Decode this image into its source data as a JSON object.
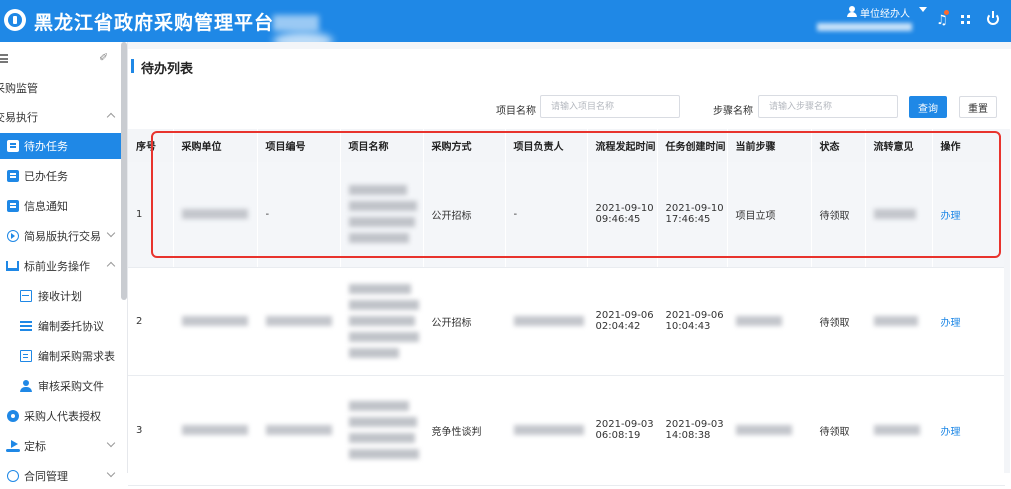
{
  "header": {
    "app_title": "黑龙江省政府采购管理平台",
    "user_name": "单位经办人",
    "brand_color": "#1f88e6"
  },
  "icons": {
    "logo": "logo-badge-icon",
    "user": "user-icon",
    "dropdown": "caret-down-icon",
    "notifications": "bell-icon",
    "apps": "grid-icon",
    "logout": "power-icon",
    "menu": "menu-toggle-icon",
    "pin": "pin-icon"
  },
  "sidebar": {
    "items": [
      {
        "label": "采购监管",
        "indent": false,
        "expanded": null
      },
      {
        "label": "交易执行",
        "indent": false,
        "expanded": true
      },
      {
        "label": "待办任务",
        "indent": true,
        "active": true
      },
      {
        "label": "已办任务",
        "indent": true
      },
      {
        "label": "信息通知",
        "indent": true
      },
      {
        "label": "简易版执行交易",
        "indent": true,
        "expanded": false
      },
      {
        "label": "标前业务操作",
        "indent": true,
        "expanded": true
      },
      {
        "label": "接收计划",
        "indent": true
      },
      {
        "label": "编制委托协议",
        "indent": true
      },
      {
        "label": "编制采购需求表",
        "indent": true
      },
      {
        "label": "审核采购文件",
        "indent": true
      },
      {
        "label": "采购人代表授权",
        "indent": false
      },
      {
        "label": "定标",
        "indent": false,
        "expanded": false
      },
      {
        "label": "合同管理",
        "indent": false,
        "expanded": false
      }
    ]
  },
  "main": {
    "page_title": "待办列表",
    "filters": {
      "project_name_label": "项目名称",
      "project_name_placeholder": "请输入项目名称",
      "step_name_label": "步骤名称",
      "step_name_placeholder": "请输入步骤名称",
      "query_label": "查询",
      "reset_label": "重置"
    },
    "table": {
      "columns": [
        "序号",
        "采购单位",
        "项目编号",
        "项目名称",
        "采购方式",
        "项目负责人",
        "流程发起时间",
        "任务创建时间",
        "当前步骤",
        "状态",
        "流转意见",
        "操作"
      ],
      "rows": [
        {
          "no": "1",
          "project_code": "-",
          "method": "公开招标",
          "manager": "-",
          "start_date": "2021-09-10",
          "start_time": "09:46:45",
          "create_date": "2021-09-10",
          "create_time": "17:46:45",
          "step": "项目立项",
          "status": "待领取",
          "action": "办理"
        },
        {
          "no": "2",
          "project_code": "",
          "method": "公开招标",
          "manager": "",
          "start_date": "2021-09-06",
          "start_time": "02:04:42",
          "create_date": "2021-09-06",
          "create_time": "10:04:43",
          "step": "",
          "status": "待领取",
          "action": "办理"
        },
        {
          "no": "3",
          "project_code": "",
          "method": "竞争性谈判",
          "manager": "",
          "start_date": "2021-09-03",
          "start_time": "06:08:19",
          "create_date": "2021-09-03",
          "create_time": "14:08:38",
          "step": "",
          "status": "待领取",
          "action": "办理"
        }
      ]
    }
  }
}
